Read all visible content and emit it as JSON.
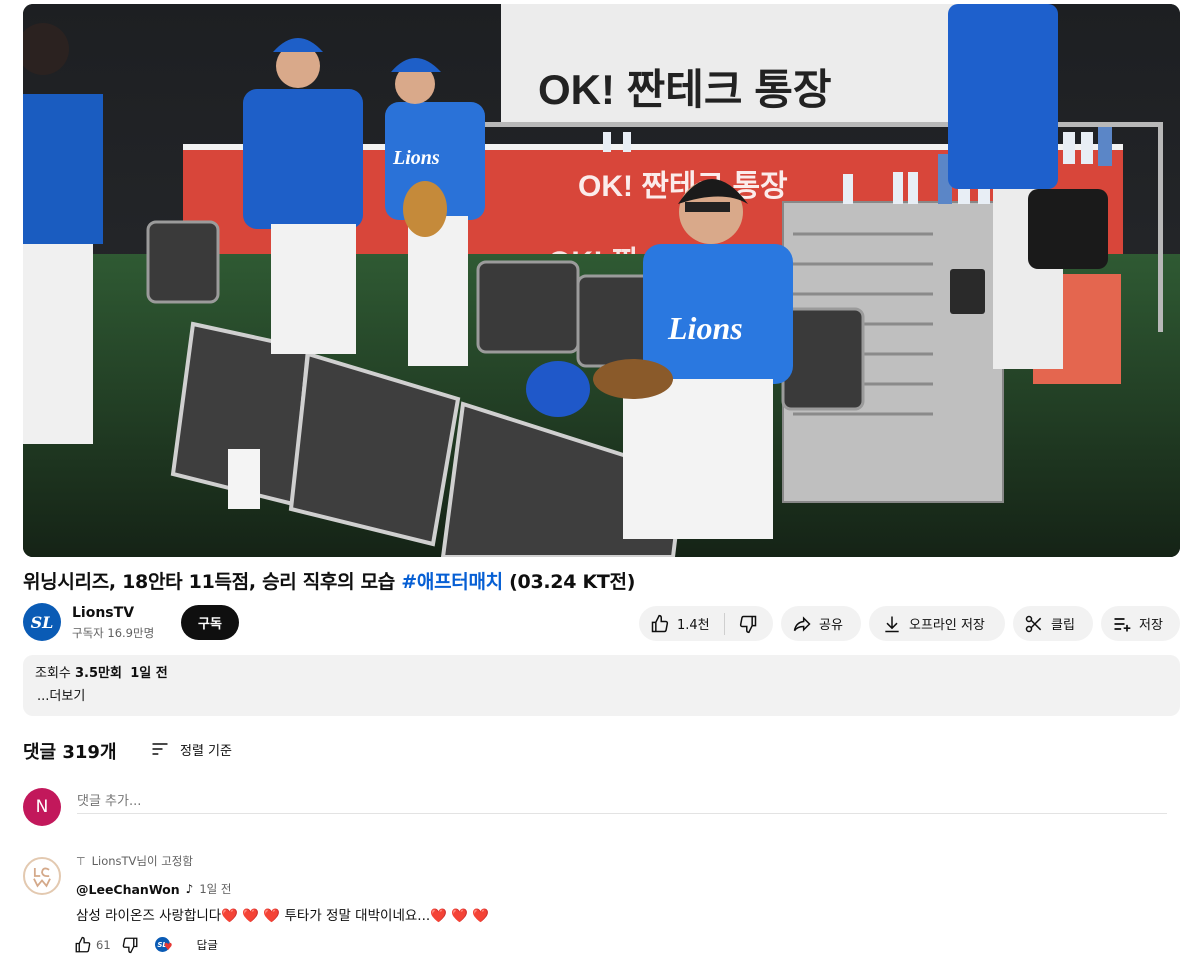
{
  "video": {
    "title_main": "위닝시리즈, 18안타 11득점, 승리 직후의 모습 ",
    "title_hashtag": "#애프터매치",
    "title_tail": " (03.24 KT전)",
    "banner_text": "OK! 짠테크 통장",
    "banner_text_2": "OK! 짠테크 통장",
    "banner_text_3": "OK! 짠",
    "jersey_text": "Lions"
  },
  "channel": {
    "avatar_text": "SL",
    "name": "LionsTV",
    "subscribers": "구독자 16.9만명",
    "subscribe_label": "구독"
  },
  "actions": {
    "like_count": "1.4천",
    "share_label": "공유",
    "offline_label": "오프라인 저장",
    "clip_label": "클립",
    "save_label": "저장"
  },
  "description": {
    "views_label": "조회수 ",
    "views": "3.5만회",
    "time": "1일 전",
    "more_label": "...더보기"
  },
  "comments": {
    "count_label": "댓글 319개",
    "sort_label": "정렬 기준",
    "user_initial": "N",
    "add_placeholder": "댓글 추가...",
    "items": [
      {
        "pinned_label": "LionsTV님이 고정함",
        "author": "@LeeChanWon",
        "note_icon": "♪",
        "time": "1일 전",
        "text": "삼성 라이온즈 사랑합니다❤️ ❤️ ❤️  투타가 정말 대박이네요...❤️ ❤️ ❤️",
        "likes": "61",
        "reply_label": "답글"
      }
    ]
  },
  "icons": {
    "like": "thumb-up-icon",
    "dislike": "thumb-down-icon",
    "share": "share-arrow-icon",
    "download": "download-icon",
    "clip": "scissors-icon",
    "save": "playlist-add-icon",
    "sort": "sort-icon",
    "pin": "pin-icon"
  },
  "colors": {
    "hashtag": "#065fd4",
    "subscribe_bg": "#0f0f0f",
    "pill_bg": "#f2f2f2",
    "user_avatar": "#c2185b",
    "lions_blue": "#0a5bb5"
  }
}
